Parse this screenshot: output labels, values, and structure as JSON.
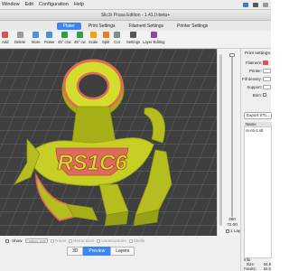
{
  "menubar": {
    "items": [
      "Window",
      "Edit",
      "Configuration",
      "Help"
    ]
  },
  "window": {
    "title": "Slic3r Prusa Edition - 1.41.0-beta+"
  },
  "tabs": [
    {
      "label": "Plater",
      "active": true
    },
    {
      "label": "Print Settings",
      "active": false
    },
    {
      "label": "Filament Settings",
      "active": false
    },
    {
      "label": "Printer Settings",
      "active": false
    }
  ],
  "toolbar": {
    "buttons": [
      {
        "label": "Add",
        "icon": "brick-add-icon",
        "color": "#d9534f"
      },
      {
        "label": "Delete",
        "icon": "brick-delete-icon",
        "color": "#9a9a9a"
      },
      {
        "label": "More",
        "icon": "plus-icon",
        "color": "#4a90e2"
      },
      {
        "label": "Fewer",
        "icon": "minus-icon",
        "color": "#4a90e2"
      },
      {
        "label": "45° ccw",
        "icon": "rotate-ccw-icon",
        "color": "#2f9e44"
      },
      {
        "label": "45° cw",
        "icon": "rotate-cw-icon",
        "color": "#2f9e44"
      },
      {
        "label": "Scale",
        "icon": "scale-icon",
        "color": "#f0a500"
      },
      {
        "label": "Split",
        "icon": "split-icon",
        "color": "#e67e22"
      },
      {
        "label": "Cut",
        "icon": "cut-icon",
        "color": "#7f8c8d"
      },
      {
        "label": "Settings",
        "icon": "settings-icon",
        "color": "#555555"
      },
      {
        "label": "Layer Editing",
        "icon": "layer-editing-icon",
        "color": "#8e44ad"
      }
    ]
  },
  "model": {
    "text": "RS1C6",
    "fill_color": "#b5bd1f",
    "top_color": "#d4dc2c",
    "perimeter_color": "#e06b5a",
    "bed_color": "#3f3f3f",
    "grid_color": "#6b6b6b"
  },
  "layer": {
    "top_height": "360",
    "bottom_height": "72.00",
    "single_layer_label": "1 Layer",
    "single_layer_checked": false
  },
  "print_settings": {
    "title": "Print settings:",
    "rows": [
      {
        "label": "Filament:",
        "color": "#d9534f"
      },
      {
        "label": "Printer:",
        "color": ""
      },
      {
        "label": "Fill density:",
        "color": ""
      },
      {
        "label": "Support:",
        "color": ""
      },
      {
        "label": "Brim:",
        "color": ""
      }
    ]
  },
  "object_list": {
    "export_label": "Export STL...",
    "header": "Name",
    "items": [
      "rs-c6-2.stl"
    ]
  },
  "info": {
    "title": "Info",
    "rows": [
      {
        "key": "Size:",
        "value": "64.8"
      },
      {
        "key": "Facets:",
        "value": "64.0"
      },
      {
        "key": "Manifold:",
        "value": "Yes"
      }
    ]
  },
  "bottom": {
    "show_label": "Show",
    "show_value": "Feature type",
    "options": [
      "Travel",
      "Retractions",
      "Unretractions",
      "Shells"
    ],
    "view_tabs": [
      {
        "label": "3D",
        "active": false
      },
      {
        "label": "Preview",
        "active": true
      },
      {
        "label": "Layers",
        "active": false
      }
    ]
  }
}
